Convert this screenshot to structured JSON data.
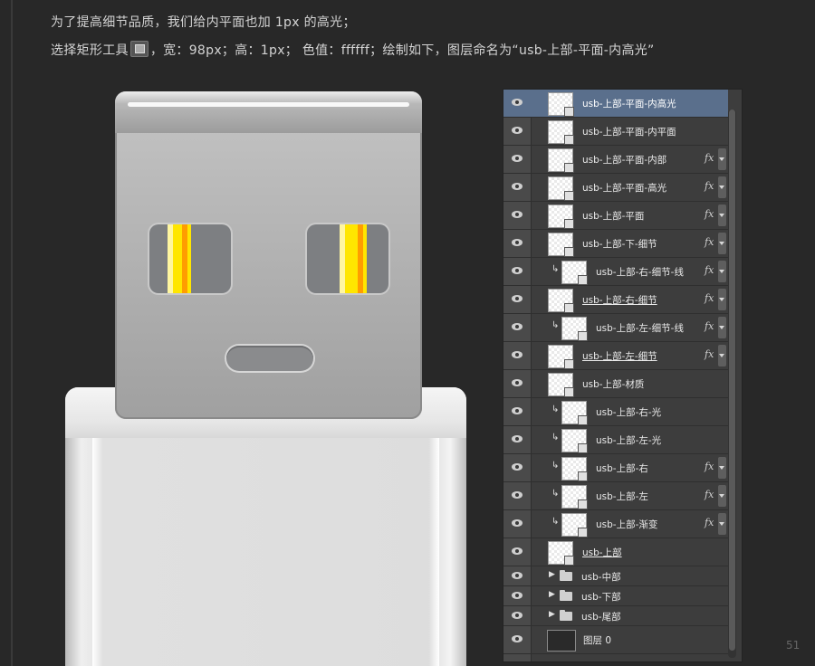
{
  "instructions": {
    "line1": "为了提高细节品质，我们给内平面也加 1px 的高光；",
    "line2_pre": "选择矩形工具",
    "line2_post": "，宽：98px；高：1px；  色值：ffffff；绘制如下，图层命名为“usb-上部-平面-内高光”"
  },
  "colors": {
    "stripe_yellow": "#ffe600",
    "stripe_orange": "#ff9d00",
    "stripe_light": "#fff6a0",
    "selected_row": "#5a6f8c"
  },
  "layers": [
    {
      "label": "usb-上部-平面-内高光",
      "selected": true,
      "fx": false,
      "clipped": false,
      "underline": false
    },
    {
      "label": "usb-上部-平面-内平面",
      "selected": false,
      "fx": false,
      "clipped": false,
      "underline": false
    },
    {
      "label": "usb-上部-平面-内部",
      "selected": false,
      "fx": true,
      "clipped": false,
      "underline": false
    },
    {
      "label": "usb-上部-平面-高光",
      "selected": false,
      "fx": true,
      "clipped": false,
      "underline": false
    },
    {
      "label": "usb-上部-平面",
      "selected": false,
      "fx": true,
      "clipped": false,
      "underline": false
    },
    {
      "label": "usb-上部-下-细节",
      "selected": false,
      "fx": true,
      "clipped": false,
      "underline": false
    },
    {
      "label": "usb-上部-右-细节-线",
      "selected": false,
      "fx": true,
      "clipped": true,
      "underline": false
    },
    {
      "label": "usb-上部-右-细节",
      "selected": false,
      "fx": true,
      "clipped": false,
      "underline": true
    },
    {
      "label": "usb-上部-左-细节-线",
      "selected": false,
      "fx": true,
      "clipped": true,
      "underline": false
    },
    {
      "label": "usb-上部-左-细节",
      "selected": false,
      "fx": true,
      "clipped": false,
      "underline": true
    },
    {
      "label": "usb-上部-材质",
      "selected": false,
      "fx": false,
      "clipped": false,
      "underline": false
    },
    {
      "label": "usb-上部-右-光",
      "selected": false,
      "fx": false,
      "clipped": true,
      "underline": false
    },
    {
      "label": "usb-上部-左-光",
      "selected": false,
      "fx": false,
      "clipped": true,
      "underline": false
    },
    {
      "label": "usb-上部-右",
      "selected": false,
      "fx": true,
      "clipped": true,
      "underline": false
    },
    {
      "label": "usb-上部-左",
      "selected": false,
      "fx": true,
      "clipped": true,
      "underline": false
    },
    {
      "label": "usb-上部-渐变",
      "selected": false,
      "fx": true,
      "clipped": true,
      "underline": false
    },
    {
      "label": "usb-上部",
      "selected": false,
      "fx": false,
      "clipped": false,
      "underline": true
    }
  ],
  "groups": [
    {
      "label": "usb-中部"
    },
    {
      "label": "usb-下部"
    },
    {
      "label": "usb-尾部"
    }
  ],
  "background_layer": {
    "label": "图层 0"
  },
  "page_number": "51"
}
